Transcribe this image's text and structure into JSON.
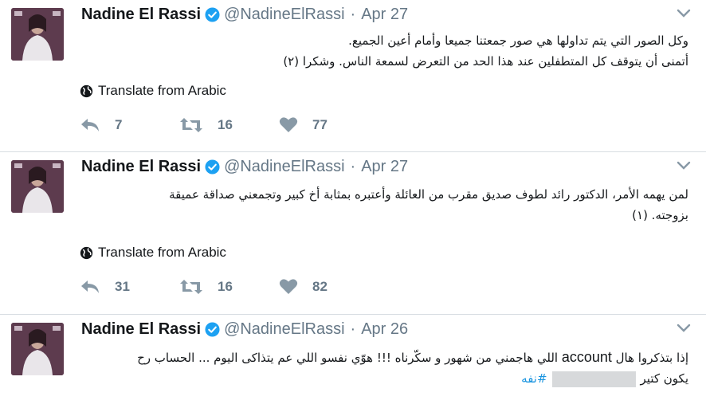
{
  "tweets": [
    {
      "name": "Nadine El Rassi",
      "handle": "@NadineElRassi",
      "separator": "·",
      "date": "Apr 27",
      "lines": [
        "وكل الصور التي يتم تداولها هي صور جمعتنا جميعا وأمام أعين الجميع.",
        "أتمنى أن يتوقف كل المتطفلين عند هذا الحد من التعرض لسمعة الناس. وشكرا (٢)"
      ],
      "translate": "Translate from Arabic",
      "replies": "7",
      "retweets": "16",
      "likes": "77"
    },
    {
      "name": "Nadine El Rassi",
      "handle": "@NadineElRassi",
      "separator": "·",
      "date": "Apr 27",
      "lines": [
        "لمن يهمه الأمر، الدكتور رائد لطوف صديق مقرب من العائلة وأعتبره بمثابة أخ كبير وتجمعني صداقة عميقة",
        "بزوجته. (١)"
      ],
      "translate": "Translate from Arabic",
      "replies": "31",
      "retweets": "16",
      "likes": "82"
    },
    {
      "name": "Nadine El Rassi",
      "handle": "@NadineElRassi",
      "separator": "·",
      "date": "Apr 26",
      "line1_before": "إذا بتذكروا هال ",
      "line1_en": "account",
      "line1_after": " اللي هاجمني من شهور و سكّرناه !!! هوّي نفسو اللي عم يتذاكى اليوم ... الحساب رح",
      "line2_start": "يكون كتير",
      "hashtag": "#نفه"
    }
  ],
  "colors": {
    "verified": "#1da1f2",
    "muted": "#657786",
    "hashtag": "#1b95e0"
  },
  "icons": [
    "avatar",
    "verified-badge-icon",
    "caret-down-icon",
    "globe-icon",
    "reply-icon",
    "retweet-icon",
    "heart-icon"
  ]
}
